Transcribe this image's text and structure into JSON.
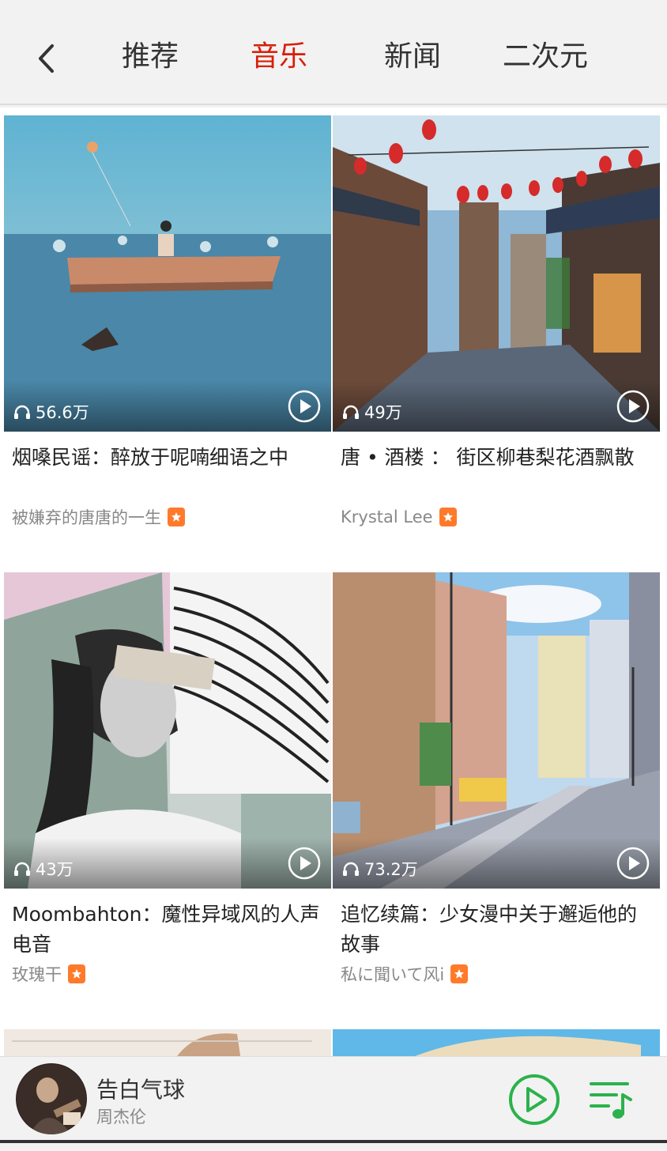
{
  "nav": {
    "tabs": [
      {
        "label": "推荐",
        "active": false
      },
      {
        "label": "音乐",
        "active": true
      },
      {
        "label": "新闻",
        "active": false
      },
      {
        "label": "二次元",
        "active": false
      }
    ],
    "active_color": "#d81e06"
  },
  "playlists": [
    {
      "plays": "56.6万",
      "title": "烟嗓民谣：醉放于呢喃细语之中",
      "author": "被嫌弃的唐唐的一生"
    },
    {
      "plays": "49万",
      "title": "唐 • 酒楼 ： 街区柳巷梨花酒飘散",
      "author": "Krystal Lee"
    },
    {
      "plays": "43万",
      "title": "Moombahton：魔性异域风的人声电音",
      "author": "玫瑰干"
    },
    {
      "plays": "73.2万",
      "title": "追忆续篇：少女漫中关于邂逅他的故事",
      "author": "私に聞いて风i"
    }
  ],
  "player": {
    "song": "告白气球",
    "artist": "周杰伦",
    "accent": "#2bb24c"
  }
}
